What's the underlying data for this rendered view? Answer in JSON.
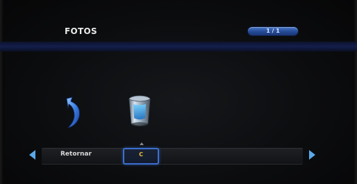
{
  "header": {
    "title": "FOTOS",
    "page_indicator": "1 / 1"
  },
  "tiles": [
    {
      "icon": "return-arrow-icon"
    },
    {
      "icon": "trash-bin-icon"
    }
  ],
  "bottom_bar": {
    "return_label": "Retornar",
    "focused_label": "C"
  },
  "colors": {
    "accent_blue": "#3c6fd0",
    "arrow_blue": "#5aa9ea",
    "focus_text": "#f0c53a",
    "header_band": "#142052"
  }
}
